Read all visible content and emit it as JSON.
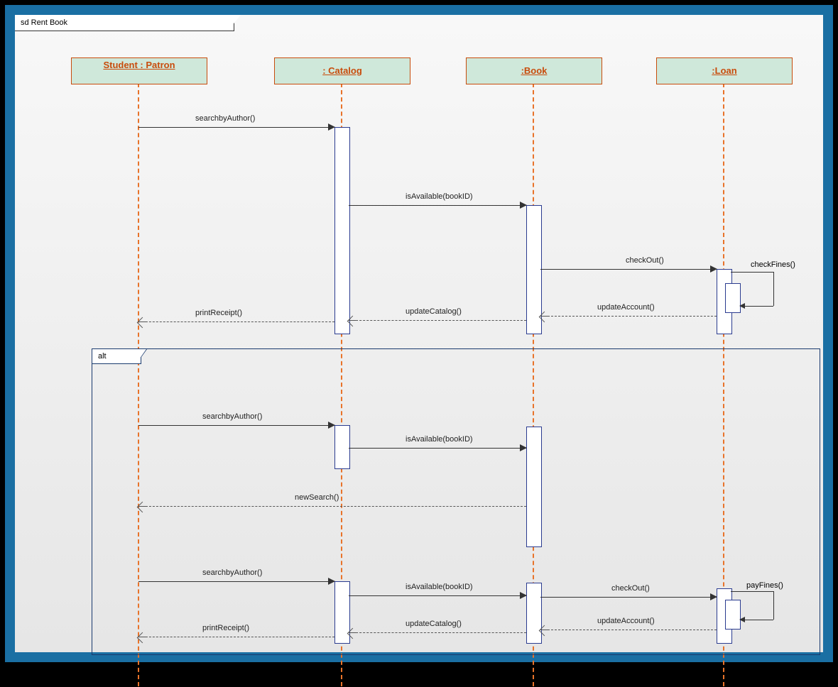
{
  "frame_title": "sd Rent Book",
  "lifelines": {
    "patron": "Student : Patron",
    "catalog": ": Catalog",
    "book": ":Book",
    "loan": ":Loan"
  },
  "messages": {
    "searchbyAuthor": "searchbyAuthor()",
    "isAvailable": "isAvailable(bookID)",
    "checkOut": "checkOut()",
    "checkFines": "checkFines()",
    "updateAccount": "updateAccount()",
    "updateCatalog": "updateCatalog()",
    "printReceipt": "printReceipt()",
    "newSearch": "newSearch()",
    "payFines": "payFines()"
  },
  "fragments": {
    "alt": "alt"
  },
  "x": {
    "patron": 174,
    "catalog": 460,
    "book": 730,
    "loan": 998
  },
  "head_w": {
    "patron": 190,
    "catalog": 190,
    "book": 190,
    "loan": 190
  },
  "chart_data": {
    "type": "uml-sequence-diagram",
    "title": "sd Rent Book",
    "participants": [
      "Student : Patron",
      ": Catalog",
      ":Book",
      ":Loan"
    ],
    "interactions": [
      {
        "from": "Student : Patron",
        "to": ": Catalog",
        "msg": "searchbyAuthor()",
        "kind": "sync"
      },
      {
        "from": ": Catalog",
        "to": ":Book",
        "msg": "isAvailable(bookID)",
        "kind": "sync"
      },
      {
        "from": ":Book",
        "to": ":Loan",
        "msg": "checkOut()",
        "kind": "sync"
      },
      {
        "from": ":Loan",
        "to": ":Loan",
        "msg": "checkFines()",
        "kind": "self"
      },
      {
        "from": ":Loan",
        "to": ":Book",
        "msg": "updateAccount()",
        "kind": "return"
      },
      {
        "from": ":Book",
        "to": ": Catalog",
        "msg": "updateCatalog()",
        "kind": "return"
      },
      {
        "from": ": Catalog",
        "to": "Student : Patron",
        "msg": "printReceipt()",
        "kind": "return"
      },
      {
        "fragment": "alt",
        "body": [
          [
            {
              "from": "Student : Patron",
              "to": ": Catalog",
              "msg": "searchbyAuthor()",
              "kind": "sync"
            },
            {
              "from": ": Catalog",
              "to": ":Book",
              "msg": "isAvailable(bookID)",
              "kind": "sync"
            },
            {
              "from": ":Book",
              "to": "Student : Patron",
              "msg": "newSearch()",
              "kind": "return"
            }
          ],
          [
            {
              "from": "Student : Patron",
              "to": ": Catalog",
              "msg": "searchbyAuthor()",
              "kind": "sync"
            },
            {
              "from": ": Catalog",
              "to": ":Book",
              "msg": "isAvailable(bookID)",
              "kind": "sync"
            },
            {
              "from": ":Book",
              "to": ":Loan",
              "msg": "checkOut()",
              "kind": "sync"
            },
            {
              "from": ":Loan",
              "to": ":Loan",
              "msg": "payFines()",
              "kind": "self"
            },
            {
              "from": ":Loan",
              "to": ":Book",
              "msg": "updateAccount()",
              "kind": "return"
            },
            {
              "from": ":Book",
              "to": ": Catalog",
              "msg": "updateCatalog()",
              "kind": "return"
            },
            {
              "from": ": Catalog",
              "to": "Student : Patron",
              "msg": "printReceipt()",
              "kind": "return"
            }
          ]
        ]
      }
    ]
  }
}
